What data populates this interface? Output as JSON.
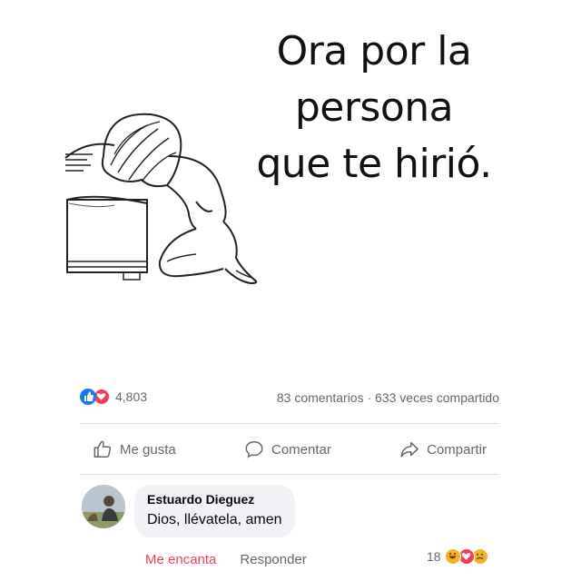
{
  "post": {
    "quote_lines": [
      "Ora por la",
      "persona",
      "que te hirió."
    ]
  },
  "stats": {
    "reaction_count": "4,803",
    "reaction_icons": [
      "like-icon",
      "love-icon"
    ],
    "comments_shares": "83 comentarios · 633 veces compartido"
  },
  "actions": {
    "like": "Me gusta",
    "comment": "Comentar",
    "share": "Compartir"
  },
  "comment": {
    "author": "Estuardo Dieguez",
    "text": "Dios, llévatela, amen",
    "love_label": "Me encanta",
    "reply_label": "Responder",
    "reaction_count": "18",
    "reaction_icons": [
      "haha-icon",
      "love-icon",
      "sad-icon"
    ]
  },
  "colors": {
    "like_blue": "#1877f2",
    "love_red": "#f33e58",
    "muted_text": "#65676b",
    "bubble_bg": "#f0f2f5"
  }
}
